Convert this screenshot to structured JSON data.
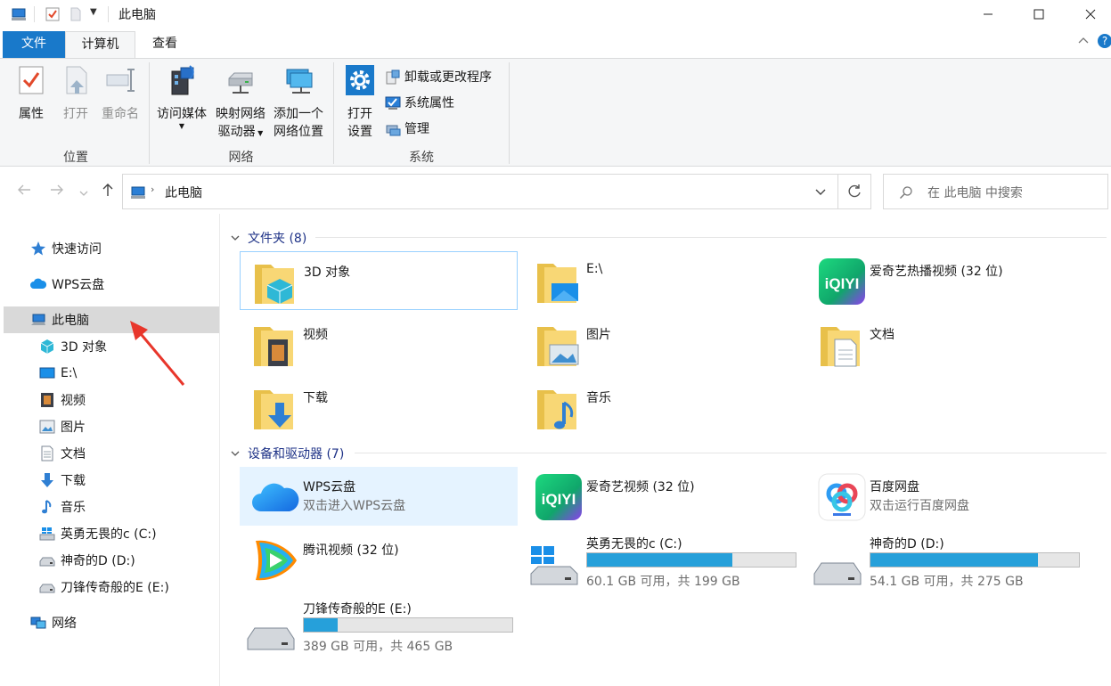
{
  "window": {
    "title": "此电脑"
  },
  "tabs": [
    {
      "label": "文件",
      "active_style": "blue"
    },
    {
      "label": "计算机",
      "active_style": "selected"
    },
    {
      "label": "查看"
    }
  ],
  "ribbon": {
    "groups": [
      {
        "label": "位置",
        "buttons": [
          "属性",
          "打开",
          "重命名"
        ]
      },
      {
        "label": "网络",
        "buttons": [
          "访问媒体",
          "映射网络驱动器",
          "添加一个网络位置"
        ]
      },
      {
        "label": "系统"
      }
    ],
    "properties": "属性",
    "open": "打开",
    "rename": "重命名",
    "media_line1": "访问媒体",
    "map_line1": "映射网络",
    "map_line2": "驱动器",
    "add_line1": "添加一个",
    "add_line2": "网络位置",
    "settings_line1": "打开",
    "settings_line2": "设置",
    "uninstall": "卸载或更改程序",
    "sysprops": "系统属性",
    "manage": "管理",
    "location_label": "位置",
    "network_label": "网络",
    "system_label": "系统"
  },
  "address": {
    "path": "此电脑",
    "search_placeholder": "在 此电脑 中搜索"
  },
  "sidebar": {
    "items": [
      {
        "label": "快速访问",
        "icon": "star-icon"
      },
      {
        "label": "WPS云盘",
        "icon": "cloud-icon"
      },
      {
        "label": "此电脑",
        "icon": "computer-icon",
        "selected": true
      },
      {
        "label": "3D 对象",
        "icon": "cube-icon"
      },
      {
        "label": "E:\\",
        "icon": "desktop-icon"
      },
      {
        "label": "视频",
        "icon": "video-icon"
      },
      {
        "label": "图片",
        "icon": "picture-icon"
      },
      {
        "label": "文档",
        "icon": "document-icon"
      },
      {
        "label": "下载",
        "icon": "download-icon"
      },
      {
        "label": "音乐",
        "icon": "music-icon"
      },
      {
        "label": "英勇无畏的c (C:)",
        "icon": "windows-drive-icon"
      },
      {
        "label": "神奇的D (D:)",
        "icon": "drive-icon"
      },
      {
        "label": "刀锋传奇般的E (E:)",
        "icon": "drive-icon"
      },
      {
        "label": "网络",
        "icon": "network-icon"
      }
    ]
  },
  "folders": {
    "header": "文件夹 (8)",
    "items": [
      {
        "name": "3D 对象"
      },
      {
        "name": "E:\\"
      },
      {
        "name": "爱奇艺热播视频 (32 位)"
      },
      {
        "name": "视频"
      },
      {
        "name": "图片"
      },
      {
        "name": "文档"
      },
      {
        "name": "下载"
      },
      {
        "name": "音乐"
      }
    ]
  },
  "devices": {
    "header": "设备和驱动器 (7)",
    "wps": {
      "name": "WPS云盘",
      "sub": "双击进入WPS云盘"
    },
    "iqiyi": {
      "name": "爱奇艺视频 (32 位)"
    },
    "baidu": {
      "name": "百度网盘",
      "sub": "双击运行百度网盘"
    },
    "tencent": {
      "name": "腾讯视频 (32 位)"
    },
    "drives": [
      {
        "name": "英勇无畏的c (C:)",
        "free": "60.1 GB 可用，共 199 GB",
        "used_fraction": 0.698
      },
      {
        "name": "神奇的D (D:)",
        "free": "54.1 GB 可用，共 275 GB",
        "used_fraction": 0.803
      },
      {
        "name": "刀锋传奇般的E (E:)",
        "free": "389 GB 可用，共 465 GB",
        "used_fraction": 0.163
      }
    ]
  },
  "colors": {
    "accent": "#1979ca",
    "bar_fill": "#26a0da",
    "selected_bg": "#d9d9d9",
    "arrow": "#e8362b"
  }
}
